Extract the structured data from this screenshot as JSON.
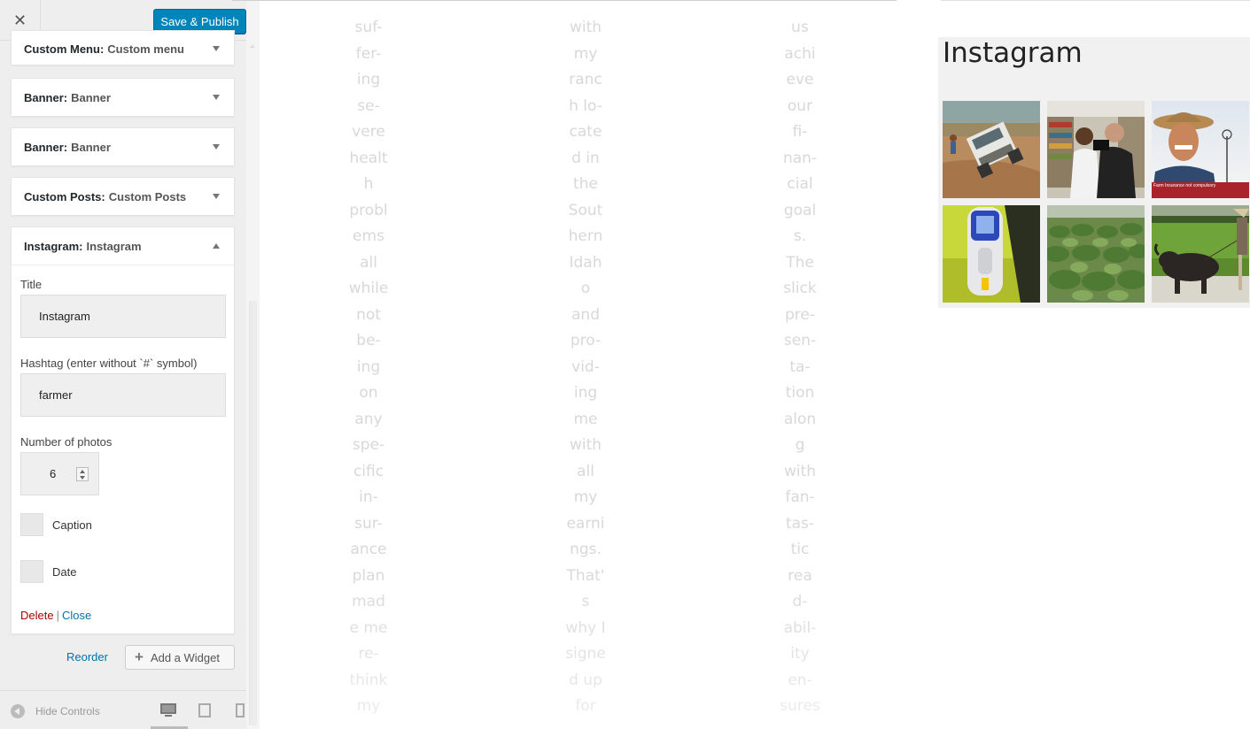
{
  "toolbar": {
    "close_icon": "close-icon",
    "publish_label": "Save & Publish"
  },
  "widgets": [
    {
      "type": "Custom Menu:",
      "name": "Custom menu"
    },
    {
      "type": "Banner:",
      "name": "Banner"
    },
    {
      "type": "Banner:",
      "name": "Banner"
    },
    {
      "type": "Custom Posts:",
      "name": "Custom Posts"
    },
    {
      "type": "Instagram:",
      "name": "Instagram"
    }
  ],
  "instagram_form": {
    "title_label": "Title",
    "title_value": "Instagram",
    "hashtag_label": "Hashtag (enter without `#` symbol)",
    "hashtag_value": "farmer",
    "photos_label": "Number of photos",
    "photos_value": "6",
    "caption_label": "Caption",
    "date_label": "Date",
    "delete_label": "Delete",
    "separator": "|",
    "close_label": "Close"
  },
  "panel_actions": {
    "reorder_label": "Reorder",
    "add_widget_label": "Add a Widget"
  },
  "footer": {
    "hide_controls_label": "Hide Controls"
  },
  "preview": {
    "col1": [
      "suf-",
      "fer-",
      "ing",
      "se-",
      "vere",
      "healt",
      "h",
      "probl",
      "ems",
      "all",
      "while",
      "not",
      "be-",
      "ing",
      "on",
      "any",
      "spe-",
      "cific",
      "in-",
      "sur-",
      "ance",
      "plan",
      "mad",
      "e me",
      "re-",
      "think",
      "my"
    ],
    "col2": [
      "with",
      "my",
      "ranc",
      "h lo-",
      "cate",
      "d in",
      "the",
      "Sout",
      "hern",
      "Idah",
      "o",
      "and",
      "pro-",
      "vid-",
      "ing",
      "me",
      "with",
      "all",
      "my",
      "earni",
      "ngs.",
      "That'",
      "s",
      "why I",
      "signe",
      "d up",
      "for"
    ],
    "col3": [
      "us",
      "achi",
      "eve",
      "our",
      "fi-",
      "nan-",
      "cial",
      "goal",
      "s.",
      "The",
      "slick",
      "pre-",
      "sen-",
      "ta-",
      "tion",
      "alon",
      "g",
      "with",
      "fan-",
      "tas-",
      "tic",
      "rea",
      "d-",
      "abil-",
      "ity",
      "en-",
      "sures"
    ],
    "instagram_title": "Instagram",
    "photo_caption": "Farm Insurance not compulsory"
  }
}
